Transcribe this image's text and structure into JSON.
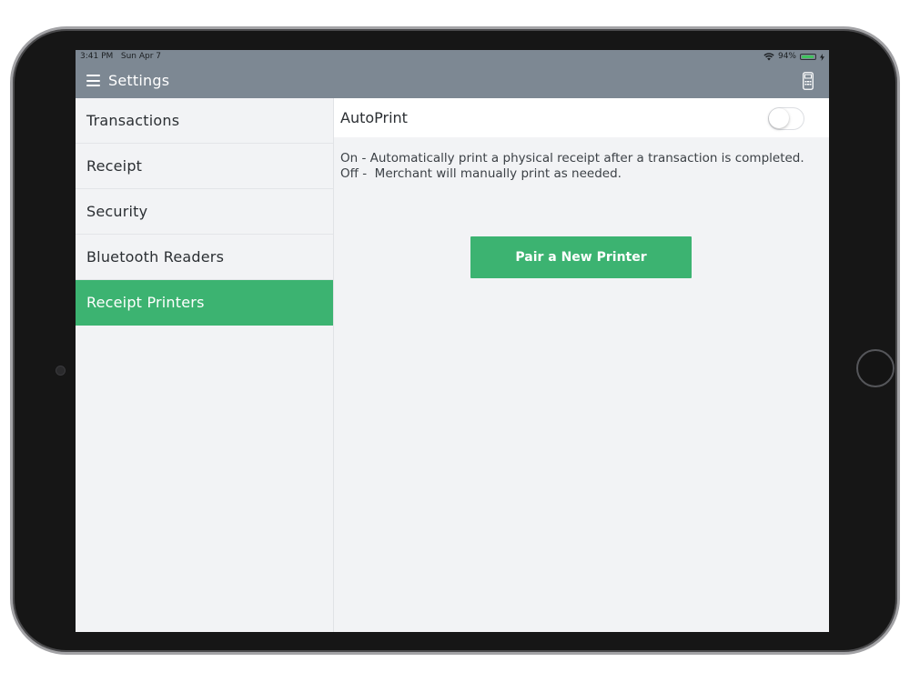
{
  "status_bar": {
    "time": "3:41 PM",
    "date": "Sun Apr 7",
    "battery_percent": "94%",
    "battery_level": 0.94,
    "icons": [
      "wifi-icon",
      "battery-icon",
      "charging-icon"
    ]
  },
  "nav": {
    "title": "Settings",
    "menu_icon": "hamburger-menu-icon",
    "right_icon": "card-reader-icon"
  },
  "sidebar": {
    "items": [
      {
        "label": "Transactions"
      },
      {
        "label": "Receipt"
      },
      {
        "label": "Security"
      },
      {
        "label": "Bluetooth Readers"
      },
      {
        "label": "Receipt Printers",
        "active": true
      }
    ]
  },
  "content": {
    "autoprint_label": "AutoPrint",
    "autoprint_enabled": false,
    "description_on": "On - Automatically print a physical receipt after a transaction is completed.",
    "description_off": "Off -  Merchant will manually print as needed.",
    "pair_button_label": "Pair a New Printer"
  },
  "colors": {
    "accent": "#3cb371",
    "nav_background": "#7d8893",
    "panel_background": "#f2f3f5",
    "battery": "#3fc35c"
  }
}
